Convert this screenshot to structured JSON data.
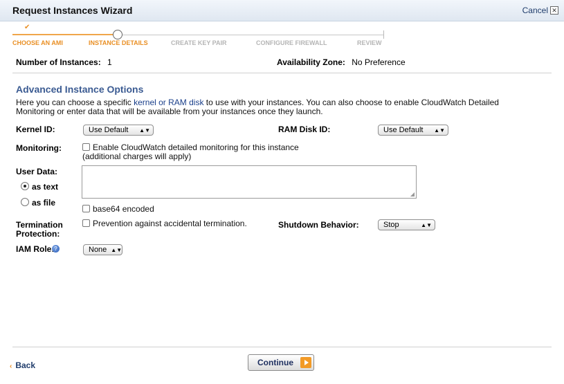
{
  "header": {
    "title": "Request Instances Wizard",
    "cancel_label": "Cancel",
    "cancel_icon": "close-icon"
  },
  "steps": [
    {
      "label": "CHOOSE AN AMI",
      "state": "done"
    },
    {
      "label": "INSTANCE DETAILS",
      "state": "current"
    },
    {
      "label": "CREATE KEY PAIR",
      "state": "upcoming"
    },
    {
      "label": "CONFIGURE FIREWALL",
      "state": "upcoming"
    },
    {
      "label": "REVIEW",
      "state": "upcoming"
    }
  ],
  "summary": {
    "instances_label": "Number of Instances:",
    "instances_value": "1",
    "zone_label": "Availability Zone:",
    "zone_value": "No Preference"
  },
  "advanced": {
    "title": "Advanced Instance Options",
    "desc_before": "Here you can choose a specific ",
    "desc_link": "kernel or RAM disk",
    "desc_after": " to use with your instances. You can also choose to enable CloudWatch Detailed Monitoring or enter data that will be available from your instances once they launch."
  },
  "form": {
    "kernel_label": "Kernel ID:",
    "kernel_value": "Use Default",
    "ramdisk_label": "RAM Disk ID:",
    "ramdisk_value": "Use Default",
    "monitoring_label": "Monitoring:",
    "monitoring_text": "Enable CloudWatch detailed monitoring for this instance",
    "monitoring_link": "(additional charges will apply)",
    "monitoring_checked": false,
    "userdata_label": "User Data:",
    "as_text": "as text",
    "as_file": "as file",
    "selected_format": "as text",
    "userdata_value": "",
    "base64_text": "base64 encoded",
    "base64_checked": false,
    "termination_label_1": "Termination",
    "termination_label_2": "Protection:",
    "termination_text": "Prevention against accidental termination.",
    "termination_checked": false,
    "shutdown_label": "Shutdown Behavior:",
    "shutdown_value": "Stop",
    "iam_label": "IAM Role:",
    "iam_value": "None",
    "iam_help_icon": "help-icon"
  },
  "footer": {
    "back_label": "Back",
    "continue_label": "Continue"
  },
  "colors": {
    "accent": "#e98f24",
    "heading": "#3b5b92",
    "link": "#1a3f8a"
  }
}
